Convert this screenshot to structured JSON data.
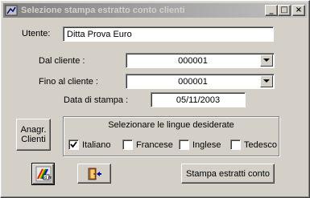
{
  "window": {
    "title": "Selezione stampa estratto conto clienti"
  },
  "titlebar_buttons": {
    "minimize": "_",
    "maximize": "□",
    "close": "×"
  },
  "form": {
    "utente_label": "Utente:",
    "utente_value": "Ditta Prova Euro",
    "dal_cliente_label": "Dal cliente  :",
    "dal_cliente_value": "000001",
    "fino_cliente_label": "Fino al cliente  :",
    "fino_cliente_value": "000001",
    "data_stampa_label": "Data di stampa  :",
    "data_stampa_value": "05/11/2003"
  },
  "anagr_button": {
    "line1": "Anagr.",
    "line2": "Clienti"
  },
  "languages": {
    "title": "Selezionare le lingue desiderate",
    "items": [
      {
        "label": "Italiano",
        "checked": true
      },
      {
        "label": "Francese",
        "checked": false
      },
      {
        "label": "Inglese",
        "checked": false
      },
      {
        "label": "Tedesco",
        "checked": false
      }
    ]
  },
  "actions": {
    "print_label": "Stampa estratti conto"
  },
  "icons": {
    "title": "app-icon",
    "config": "chart-settings-icon",
    "exit": "exit-door-icon",
    "dropdown": "chevron-down-icon"
  }
}
